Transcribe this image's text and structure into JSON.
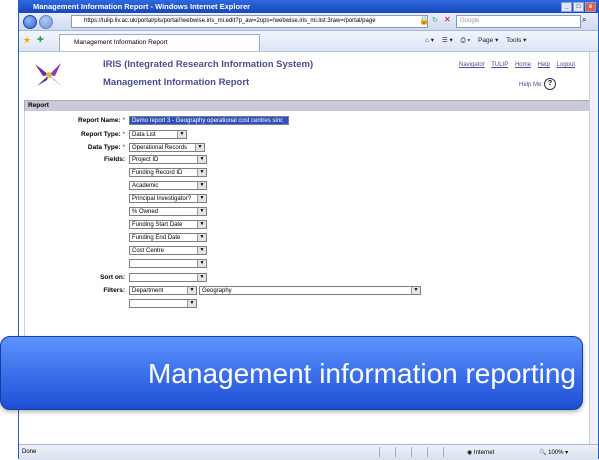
{
  "window": {
    "title": "Management Information Report - Windows Internet Explorer",
    "url": "https://tulip.liv.ac.uk/portal/pls/portal/!webwise.iris_mi.edit?p_aw=2ops=!webwise.iris_mi.list:3raw=/portal/page",
    "search_placeholder": "Google",
    "tab_label": "Management Information Report",
    "commands": [
      "Page ▾",
      "Tools ▾"
    ]
  },
  "header": {
    "app_title": "IRIS (Integrated Research Information System)",
    "page_title": "Management Information Report",
    "links": [
      "Navigator",
      "TULIP",
      "Home",
      "Help",
      "Logout"
    ],
    "help_label": "Help Me:"
  },
  "section": {
    "title": "Report"
  },
  "form": {
    "report_name_label": "Report Name:",
    "report_name_value": "Demo report 3 - Geography operational cost centres sinc",
    "report_type_label": "Report Type:",
    "report_type_value": "Data List",
    "data_type_label": "Data Type:",
    "data_type_value": "Operational Records",
    "fields_label": "Fields:",
    "fields": [
      "Project ID",
      "Funding Record ID",
      "Academic",
      "Principal Investigator?",
      "% Owned",
      "Funding Start Date",
      "Funding End Date",
      "Cost Centre",
      ""
    ],
    "sort_label": "Sort on:",
    "sort_value": "",
    "filters_label": "Filters:",
    "filter_field": "Department",
    "filter_value": "Geography",
    "filter_extra": "",
    "required_marker": "*"
  },
  "banner": {
    "text": "Management information reporting"
  },
  "status": {
    "text": "Done",
    "zone": "Internet",
    "zoom": "100%"
  },
  "colors": {
    "accent": "#4b4e8f",
    "banner": "#2d62e8"
  }
}
